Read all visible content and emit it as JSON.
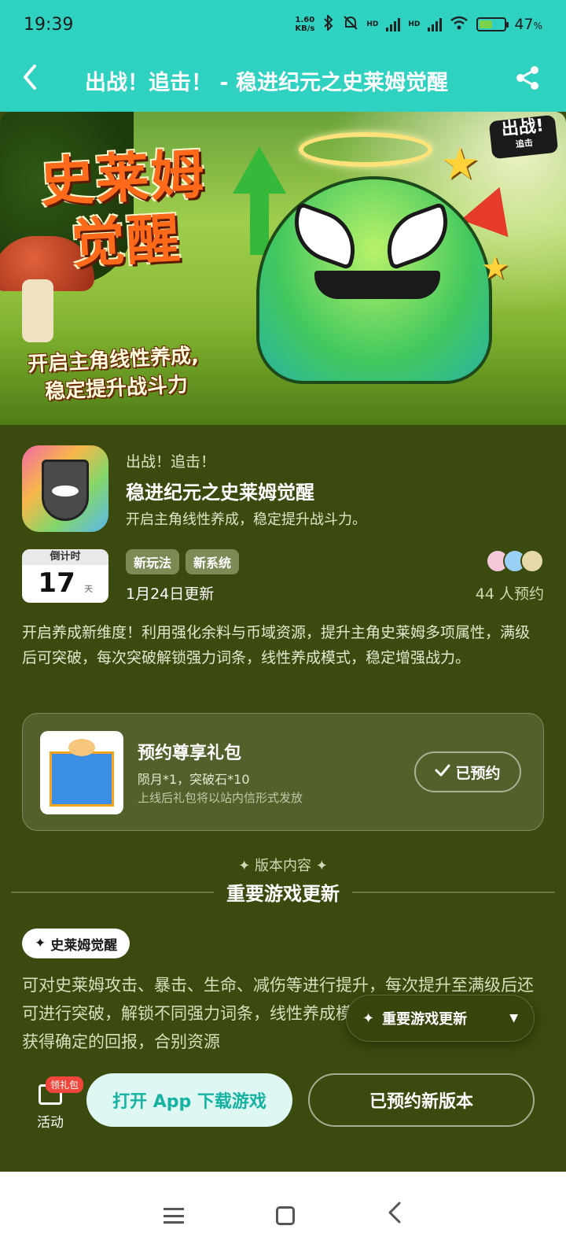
{
  "status_bar": {
    "time": "19:39",
    "net_speed_value": "1.60",
    "net_speed_unit": "KB/s",
    "network1": "HD",
    "network2": "HD",
    "battery": "47",
    "battery_unit": "%",
    "battery_level": 0.47
  },
  "navbar": {
    "title": "出战！追击！ - 稳进纪元之史莱姆觉醒"
  },
  "banner": {
    "logo_text": "史莱姆觉醒",
    "slogan_line1": "开启主角线性养成,",
    "slogan_line2": "稳定提升战斗力",
    "corner_badge": "出战!",
    "corner_badge_sub": "追击"
  },
  "app": {
    "name_small": "出战！追击！",
    "name": "稳进纪元之史莱姆觉醒",
    "subtitle": "开启主角线性养成，稳定提升战斗力。",
    "countdown_label": "倒计时",
    "countdown_value": "17",
    "countdown_unit": "天",
    "tags": [
      "新玩法",
      "新系统"
    ],
    "update_date": "1月24日更新",
    "booked_count": "44 人预约",
    "description": "开启养成新维度！利用强化余料与币域资源，提升主角史莱姆多项属性，满级后可突破，每次突破解锁强力词条，线性养成模式，稳定增强战力。"
  },
  "gift": {
    "title": "预约尊享礼包",
    "items": "陨月*1，突破石*10",
    "note": "上线后礼包将以站内信形式发放",
    "button": "已预约"
  },
  "section": {
    "subtitle": "✦ 版本内容 ✦",
    "title": "重要游戏更新",
    "pill": "史莱姆觉醒",
    "body": "可对史莱姆攻击、暴击、生命、减伤等进行提升，每次提升至满级后还可进行突破，解锁不同强力词条，线性养成模式，确保每一次投入都能获得确定的回报，合别资源",
    "float_jump": "重要游戏更新"
  },
  "bottom": {
    "activity_badge": "领礼包",
    "activity_label": "活动",
    "open_app": "打开 App 下载游戏",
    "booked_version": "已预约新版本"
  },
  "colors": {
    "header": "#2fd1c0",
    "background": "#3b4a0e",
    "open_btn_text": "#15b2a2"
  }
}
